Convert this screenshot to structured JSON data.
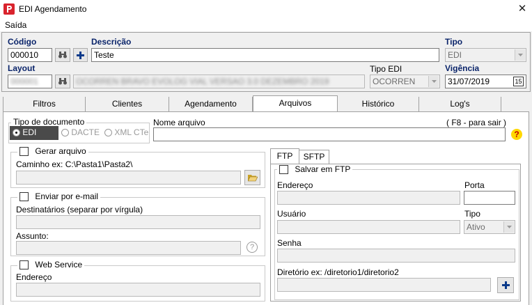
{
  "window": {
    "title": "EDI Agendamento",
    "close_glyph": "✕"
  },
  "menu": {
    "items": [
      "Saída"
    ]
  },
  "header": {
    "codigo_label": "Código",
    "codigo_value": "000010",
    "descricao_label": "Descrição",
    "descricao_value": "Teste",
    "tipo_label": "Tipo",
    "tipo_value": "EDI",
    "layout_label": "Layout",
    "layout_code": "000001",
    "layout_desc": "OCORREN  BRAVO  EVOLOG  VIAL  VERSAO 3.0  DEZEMBRO 2019",
    "tipo_edi_label": "Tipo EDI",
    "tipo_edi_value": "OCORREN",
    "vigencia_label": "Vigência",
    "vigencia_value": "31/07/2019",
    "calendar_glyph": "15"
  },
  "tabs": [
    "Filtros",
    "Clientes",
    "Agendamento",
    "Arquivos",
    "Histórico",
    "Log's"
  ],
  "arquivos": {
    "tipo_documento": {
      "title": "Tipo de documento",
      "options": [
        "EDI",
        "DACTE",
        "XML CTe"
      ],
      "selected": "EDI"
    },
    "nome_arquivo_label": "Nome arquivo",
    "nome_arquivo_hint": "( F8 - para sair )",
    "nome_arquivo_value": "",
    "help_glyph": "?",
    "gerar_arquivo": {
      "label": "Gerar arquivo",
      "caminho_label": "Caminho ex: C:\\Pasta1\\Pasta2\\"
    },
    "email": {
      "label": "Enviar por e-mail",
      "destinatarios_label": "Destinatários (separar por vírgula)",
      "assunto_label": "Assunto:"
    },
    "webservice": {
      "label": "Web Service",
      "endereco_label": "Endereço"
    },
    "ftp_tabs": [
      "FTP",
      "SFTP"
    ],
    "ftp": {
      "salvar_label": "Salvar em FTP",
      "endereco_label": "Endereço",
      "porta_label": "Porta",
      "usuario_label": "Usuário",
      "tipo_label": "Tipo",
      "tipo_value": "Ativo",
      "senha_label": "Senha",
      "diretorio_label": "Diretório ex: /diretorio1/diretorio2"
    }
  },
  "colors": {
    "label_blue": "#0a246a",
    "plus_blue": "#0a3a8a",
    "help_yellow": "#ffd800",
    "app_icon_red": "#d9232d"
  }
}
